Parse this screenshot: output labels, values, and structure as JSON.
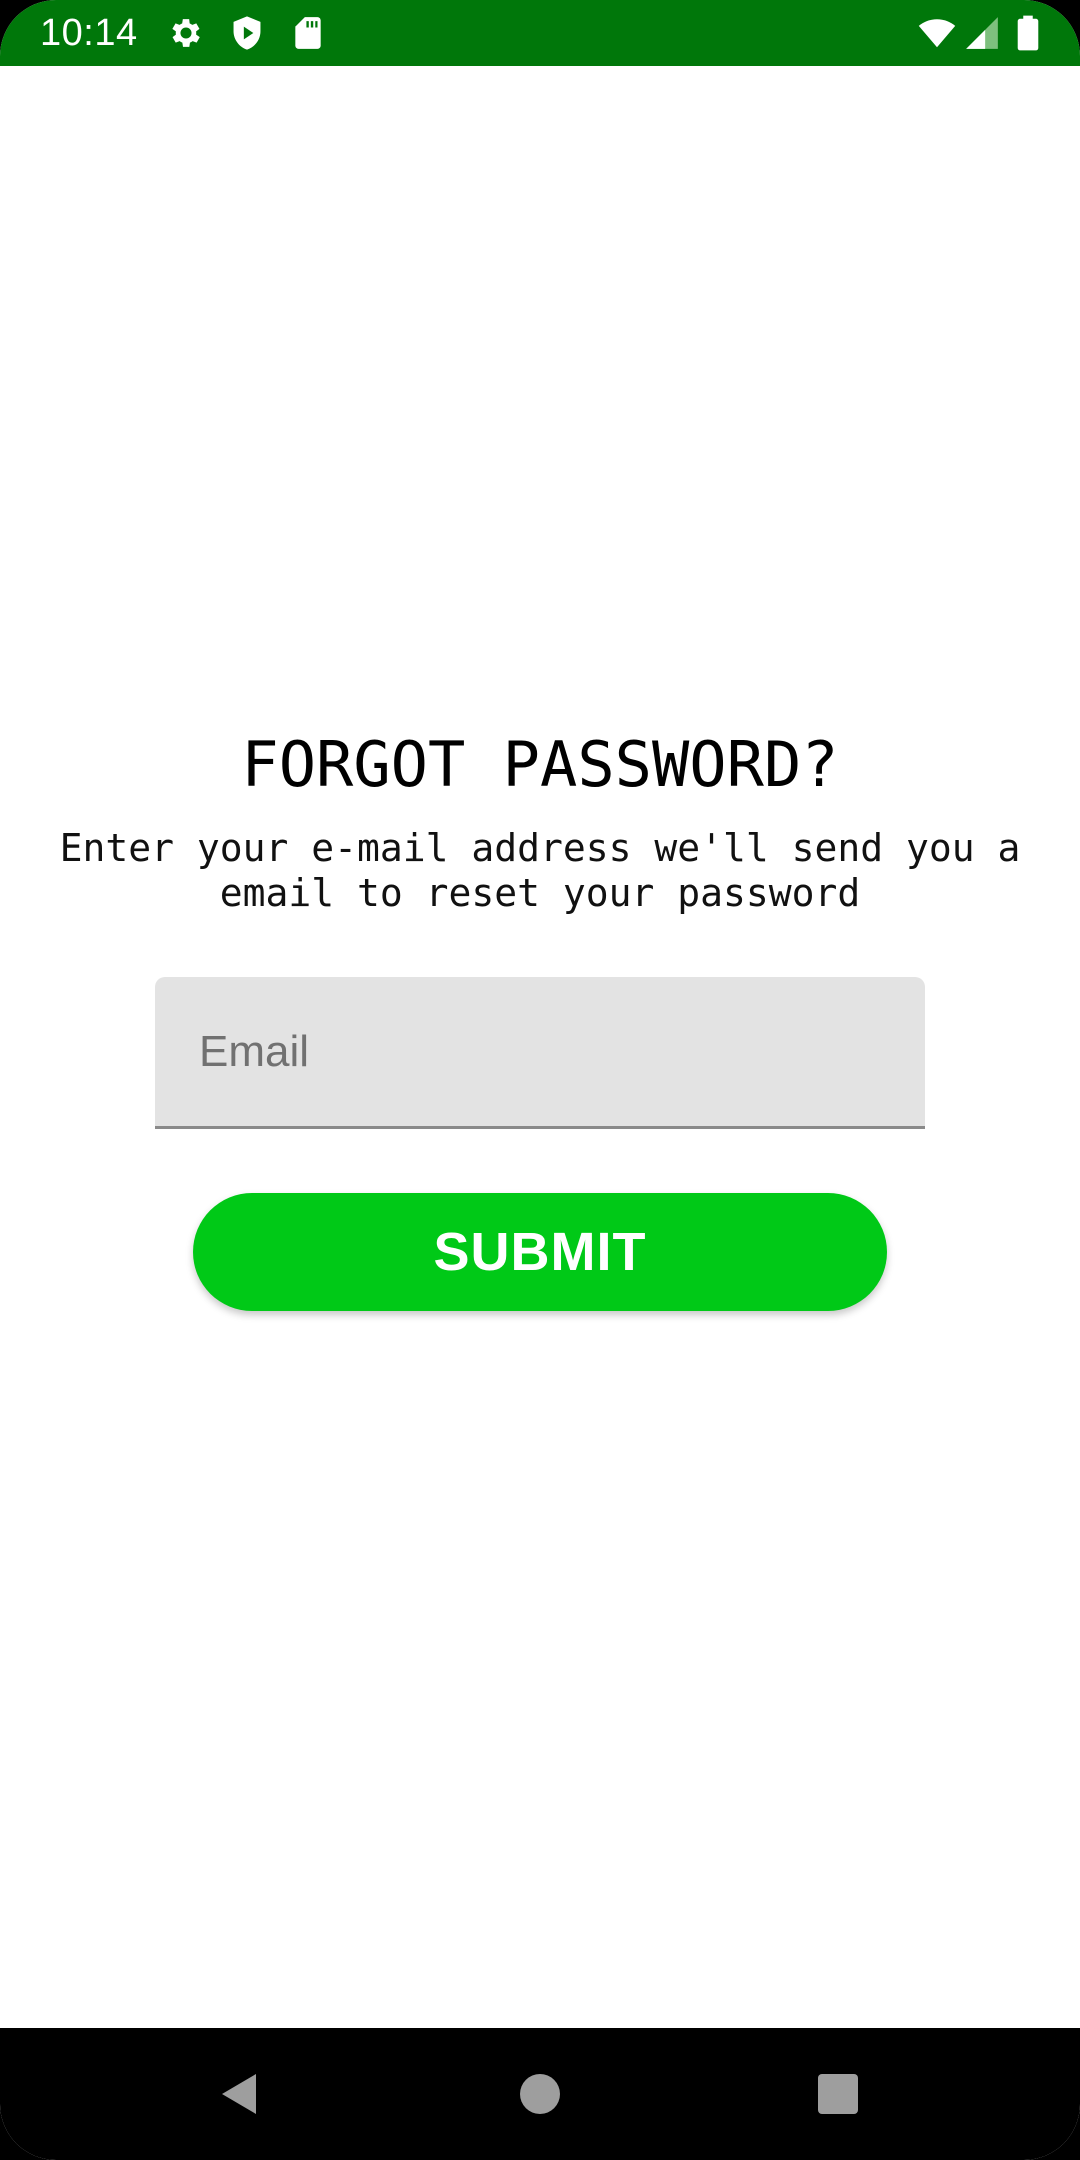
{
  "status_bar": {
    "time": "10:14",
    "left_icons": [
      "settings-icon",
      "shield-play-icon",
      "sd-card-icon"
    ],
    "right_icons": [
      "wifi-icon",
      "cell-signal-icon",
      "battery-icon"
    ],
    "background_color": "#00770a"
  },
  "main": {
    "title": "FORGOT PASSWORD?",
    "subtitle": "Enter your e-mail address we'll send you a email to reset your password",
    "email_field": {
      "placeholder": "Email",
      "value": ""
    },
    "submit_label": "SUBMIT",
    "accent_color": "#00c917"
  },
  "nav_bar": {
    "buttons": [
      "back-icon",
      "home-icon",
      "recents-icon"
    ]
  }
}
